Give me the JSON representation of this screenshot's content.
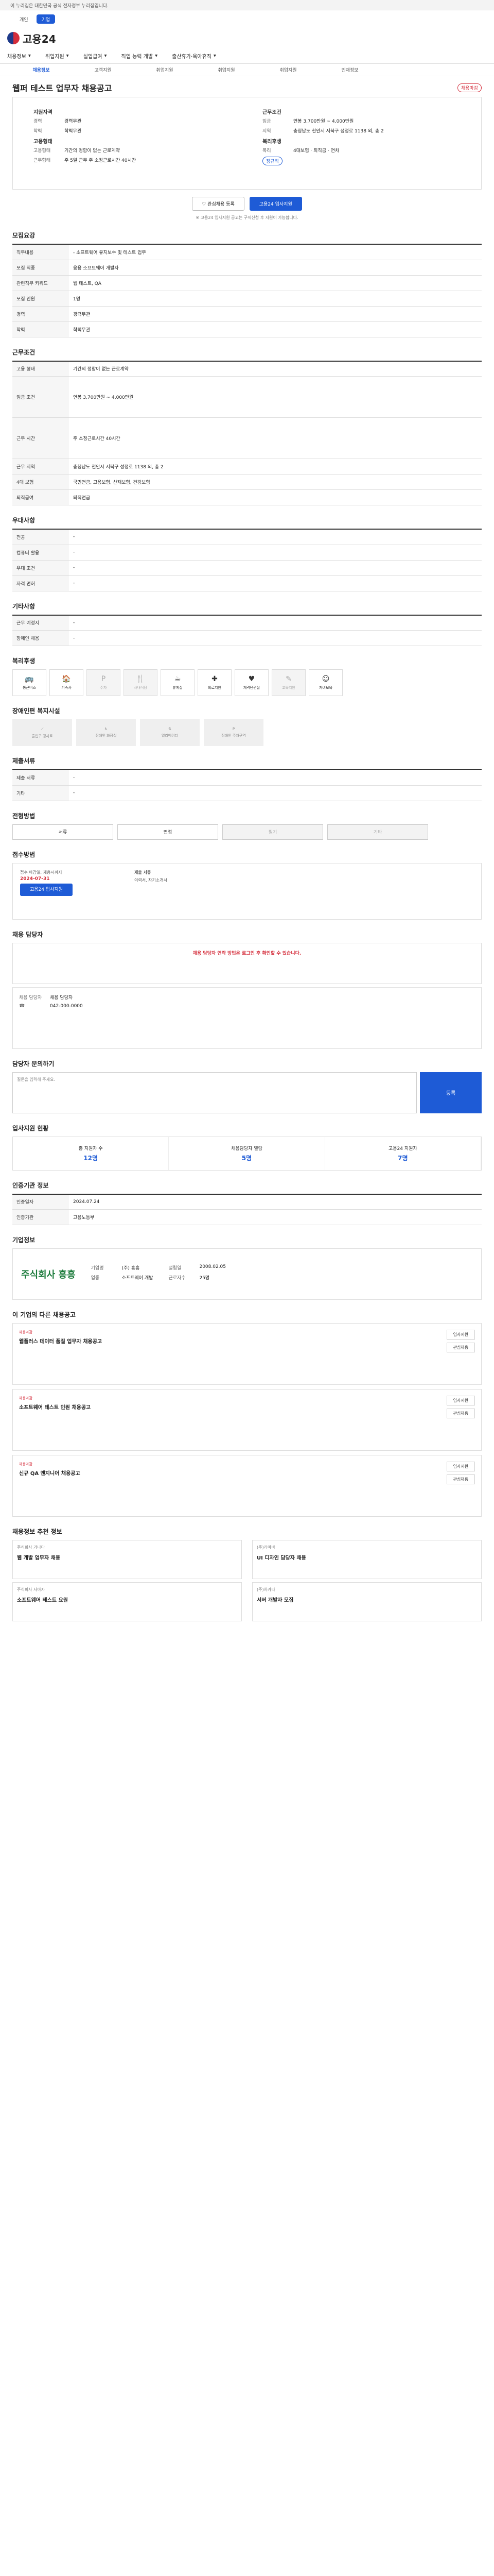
{
  "top": {
    "notice": "이 누리집은 대한민국 공식 전자정부 누리집입니다."
  },
  "tabs": [
    {
      "label": "개인"
    },
    {
      "label": "기업"
    }
  ],
  "brand": {
    "name": "고용24"
  },
  "gnb": [
    "채용정보",
    "취업지원",
    "실업급여",
    "직업 능력 개발",
    "출산휴가·육아휴직"
  ],
  "subnav": [
    "채용정보",
    "고객지원",
    "취업지원",
    "취업지원",
    "취업지원",
    "인재정보"
  ],
  "job": {
    "title": "웹퍼 테스트 업무자 채용공고",
    "badge": "채용마감",
    "tag": "정규직",
    "left_head": "지원자격",
    "right_head": "근무조건",
    "left": [
      {
        "k": "경력",
        "v": "경력무관"
      },
      {
        "k": "학력",
        "v": "학력무관"
      }
    ],
    "right": [
      {
        "k": "임금",
        "v": "연봉 3,700만원 ~ 4,000만원"
      },
      {
        "k": "지역",
        "v": "충청남도 천안시 서북구 성정로 1138 외, 총 2"
      }
    ],
    "left2_head": "고용형태",
    "left2": [
      {
        "k": "고용형태",
        "v": "기간의 정함이 없는 근로계약"
      },
      {
        "k": "근무형태",
        "v": "주 5일 근무 주 소정근로시간 40시간"
      }
    ],
    "right2_head": "복리후생",
    "right2": [
      {
        "k": "복리",
        "v": "4대보험 · 퇴직금 · 연차"
      }
    ],
    "btn_scrap": "관심채용 등록",
    "btn_apply": "고용24 입사지원",
    "note": "※ 고용24 입사지원 공고는 구직신청 후 지원이 가능합니다."
  },
  "sections": {
    "recruit": "모집요강",
    "condition": "근무조건",
    "welfare": "우대사항",
    "etc": "기타사항",
    "facility": "복리후생",
    "disabled": "장애인편 복지시설",
    "docs": "제출서류",
    "process": "전형방법",
    "apply": "접수방법",
    "manager": "채용 담당자",
    "inquiry": "담당자 문의하기",
    "stats": "입사지원 현황",
    "info": "인증기관 정보",
    "company": "기업정보",
    "others": "이 기업의 다른 채용공고",
    "recommend": "채용정보 추천 정보"
  },
  "recruit_rows": [
    {
      "k": "직무내용",
      "v": "- 소프트웨어 유지보수 및 테스트 업무"
    },
    {
      "k": "모집 직종",
      "v": "응용 소프트웨어 개발자"
    },
    {
      "k": "관련직무 키워드",
      "v": "웹 테스트, QA"
    },
    {
      "k": "모집 인원",
      "v": "1명"
    },
    {
      "k": "경력",
      "v": "경력무관"
    },
    {
      "k": "학력",
      "v": "학력무관"
    }
  ],
  "condition_rows": [
    {
      "k": "고용 형태",
      "v": "기간의 정함이 없는 근로계약"
    },
    {
      "k": "임금 조건",
      "v": "연봉 3,700만원 ~ 4,000만원"
    },
    {
      "k": "근무 시간",
      "v": "주 소정근로시간 40시간"
    },
    {
      "k": "근무 지역",
      "v": "충청남도 천안시 서북구 성정로 1138 외, 총 2"
    },
    {
      "k": "4대 보험",
      "v": "국민연금, 고용보험, 산재보험, 건강보험"
    },
    {
      "k": "퇴직급여",
      "v": "퇴직연금"
    }
  ],
  "welfare_rows": [
    {
      "k": "전공",
      "v": "-"
    },
    {
      "k": "컴퓨터 활용",
      "v": "-"
    },
    {
      "k": "우대 조건",
      "v": "-"
    },
    {
      "k": "자격 면허",
      "v": "-"
    }
  ],
  "etc_rows": [
    {
      "k": "근무 예정지",
      "v": "-"
    },
    {
      "k": "장애인 채용",
      "v": "-"
    }
  ],
  "facilities": [
    "통근버스",
    "기숙사",
    "주차",
    "사내식당",
    "휴게실",
    "의료지원",
    "체력단련실",
    "교육지원",
    "자녀보육"
  ],
  "disabled_fac": [
    "출입구 경사로",
    "장애인 화장실",
    "엘리베이터",
    "장애인 주차구역"
  ],
  "docs_rows": [
    {
      "k": "제출 서류",
      "v": "-"
    },
    {
      "k": "기타",
      "v": "-"
    }
  ],
  "process_tabs": [
    "서류",
    "면접",
    "필기",
    "기타"
  ],
  "apply_info": {
    "method": "접수 마감일: 채용시까지",
    "deadline": "2024-07-31",
    "btn": "고용24 입사지원",
    "doc_head": "제출 서류",
    "doc": "이력서, 자기소개서"
  },
  "manager_notice": "채용 담당자 연락 방법은 로그인 후 확인할 수 있습니다.",
  "manager": {
    "name": "채용 담당자",
    "tel": "042-000-0000"
  },
  "inquiry_placeholder": "질문을 입력해 주세요.",
  "inquiry_btn": "등록",
  "stats": [
    {
      "k": "총 지원자 수",
      "v": "12명"
    },
    {
      "k": "채용담당자 열람",
      "v": "5명"
    },
    {
      "k": "고용24 지원자",
      "v": "7명"
    }
  ],
  "info_rows": [
    {
      "k": "인증일자",
      "v": "2024.07.24"
    },
    {
      "k": "인증기관",
      "v": "고용노동부"
    }
  ],
  "company": {
    "logo": "주식회사 흥흥",
    "rows": [
      {
        "k": "기업명",
        "v": "(주) 흥흥"
      },
      {
        "k": "업종",
        "v": "소프트웨어 개발"
      },
      {
        "k": "설립일",
        "v": "2008.02.05"
      },
      {
        "k": "근로자수",
        "v": "25명"
      }
    ]
  },
  "others": [
    {
      "label": "채용마감",
      "title": "웹플러스 데이터 품질 업무자 채용공고"
    },
    {
      "label": "채용마감",
      "title": "소프트웨어 테스트 인원 채용공고"
    },
    {
      "label": "채용마감",
      "title": "신규 QA 엔지니어 채용공고"
    }
  ],
  "others_btns": [
    "입사지원",
    "관심채용"
  ],
  "recommend": [
    {
      "name": "주식회사 가나다",
      "title": "웹 개발 업무자 채용"
    },
    {
      "name": "(주)라마바",
      "title": "UI 디자인 담당자 채용"
    },
    {
      "name": "주식회사 사아자",
      "title": "소프트웨어 테스트 요원"
    },
    {
      "name": "(주)차카타",
      "title": "서버 개발자 모집"
    }
  ]
}
